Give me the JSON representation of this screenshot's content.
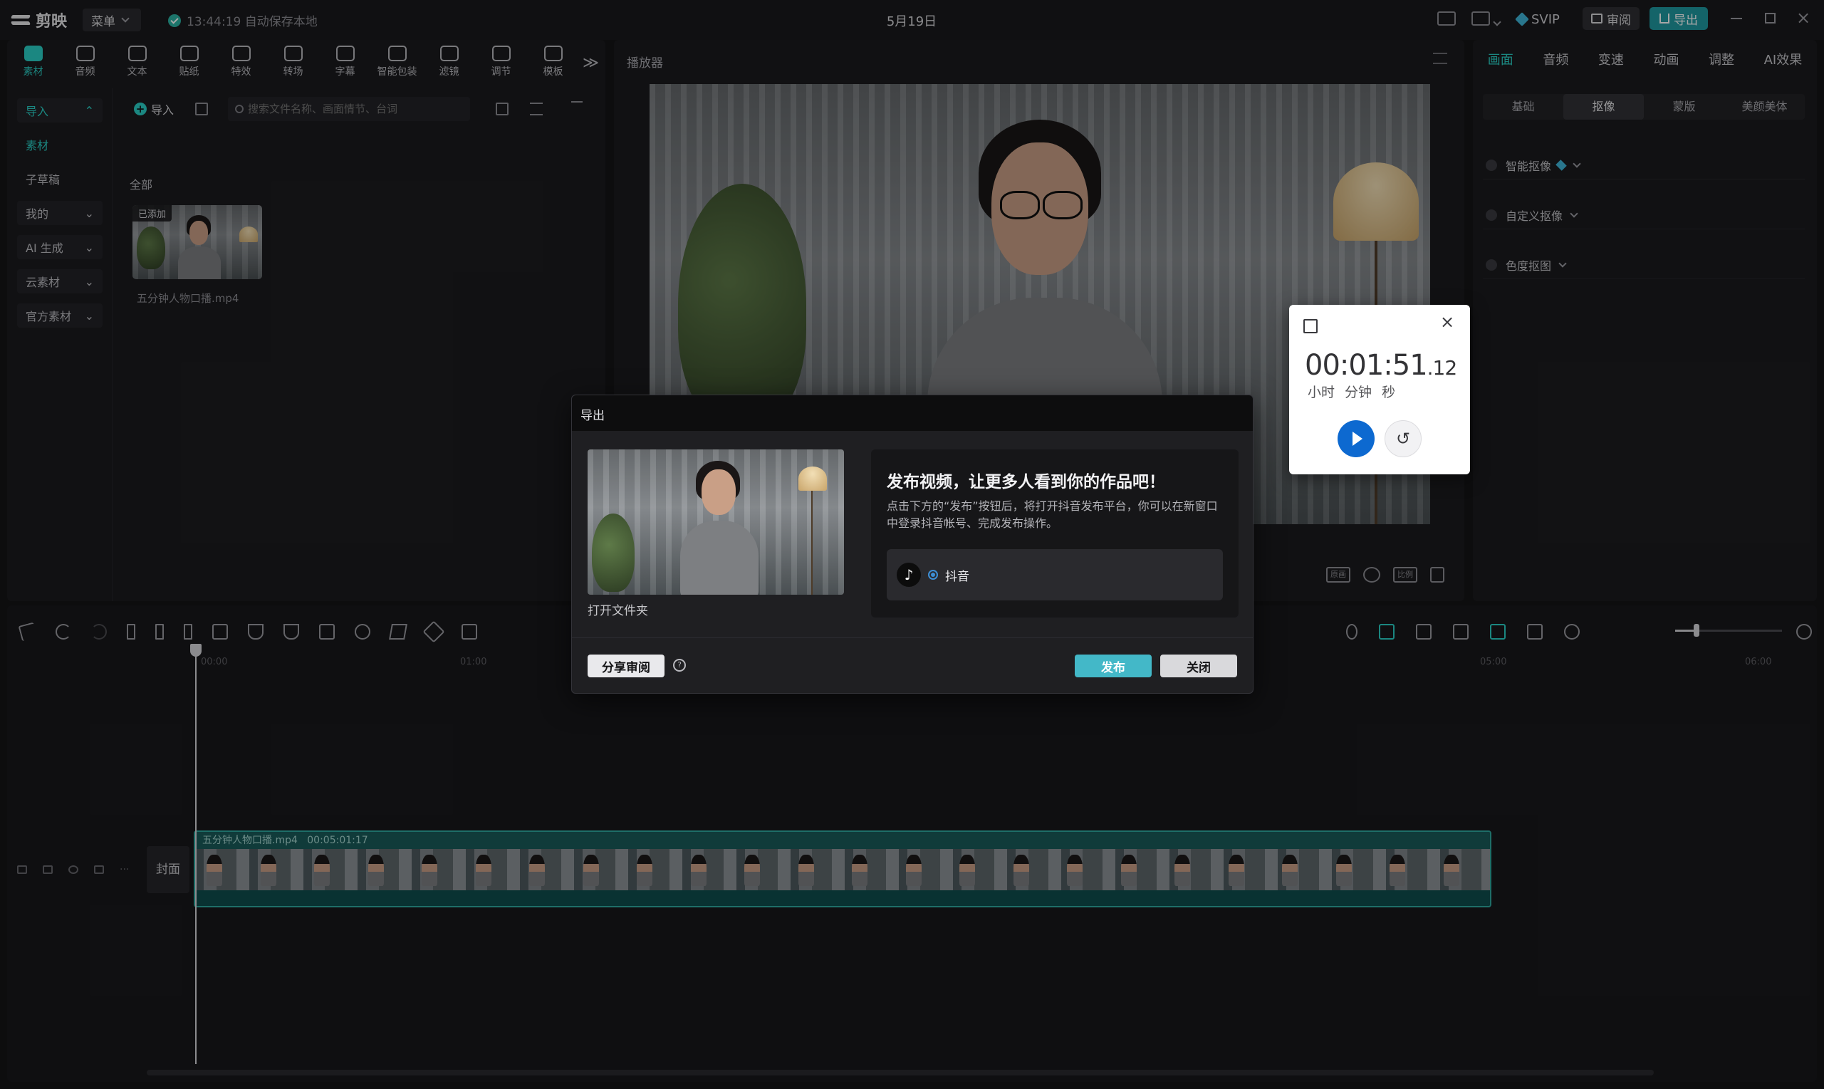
{
  "app": {
    "name": "剪映",
    "menu_label": "菜单",
    "autosave": "13:44:19 自动保存本地",
    "project_title": "5月19日",
    "svip": "SVIP",
    "review_label": "审阅",
    "export_label": "导出"
  },
  "toolbar": {
    "tabs": [
      {
        "label": "素材",
        "icon": "media-icon"
      },
      {
        "label": "音频",
        "icon": "audio-icon"
      },
      {
        "label": "文本",
        "icon": "text-icon"
      },
      {
        "label": "贴纸",
        "icon": "sticker-icon"
      },
      {
        "label": "特效",
        "icon": "effects-icon"
      },
      {
        "label": "转场",
        "icon": "transition-icon"
      },
      {
        "label": "字幕",
        "icon": "subtitle-icon"
      },
      {
        "label": "智能包装",
        "icon": "smart-pack-icon"
      },
      {
        "label": "滤镜",
        "icon": "filter-icon"
      },
      {
        "label": "调节",
        "icon": "adjust-icon"
      },
      {
        "label": "模板",
        "icon": "template-icon"
      }
    ],
    "more": "≫"
  },
  "sidebar": {
    "items": [
      {
        "label": "导入",
        "chev": "⌃"
      },
      {
        "label": "素材",
        "chev": ""
      },
      {
        "label": "子草稿",
        "chev": ""
      },
      {
        "label": "我的",
        "chev": "⌄"
      },
      {
        "label": "AI 生成",
        "chev": "⌄"
      },
      {
        "label": "云素材",
        "chev": "⌄"
      },
      {
        "label": "官方素材",
        "chev": "⌄"
      }
    ]
  },
  "media": {
    "import_label": "导入",
    "search_placeholder": "搜索文件名称、画面情节、台词",
    "all_label": "全部",
    "added_badge": "已添加",
    "file_name": "五分钟人物口播.mp4"
  },
  "player": {
    "title": "播放器",
    "ctrl_labels": [
      "原画",
      "比例"
    ]
  },
  "inspector": {
    "tabs": [
      "画面",
      "音频",
      "变速",
      "动画",
      "调整",
      "AI效果"
    ],
    "subtabs": [
      "基础",
      "抠像",
      "蒙版",
      "美颜美体"
    ],
    "rows": [
      "智能抠像",
      "自定义抠像",
      "色度抠图"
    ]
  },
  "timeline": {
    "ruler": [
      "00:00",
      "01:00",
      "05:00",
      "06:00"
    ],
    "cover_label": "封面",
    "clip_name": "五分钟人物口播.mp4",
    "clip_duration": "00:05:01:17"
  },
  "export_dialog": {
    "title": "导出",
    "open_folder": "打开文件夹",
    "publish_title": "发布视频，让更多人看到你的作品吧！",
    "publish_desc": "点击下方的“发布”按钮后，将打开抖音发布平台，你可以在新窗口中登录抖音帐号、完成发布操作。",
    "platform": "抖音",
    "share_review": "分享审阅",
    "publish": "发布",
    "close": "关闭"
  },
  "stopwatch": {
    "time_main": "00:01:51",
    "time_fraction": ".12",
    "units": [
      "小时",
      "分钟",
      "秒"
    ]
  },
  "colors": {
    "accent": "#2ad0c6",
    "export_button": "#1f9aa1",
    "publish_button": "#43b8c8",
    "stopwatch_play": "#0d69d0"
  }
}
